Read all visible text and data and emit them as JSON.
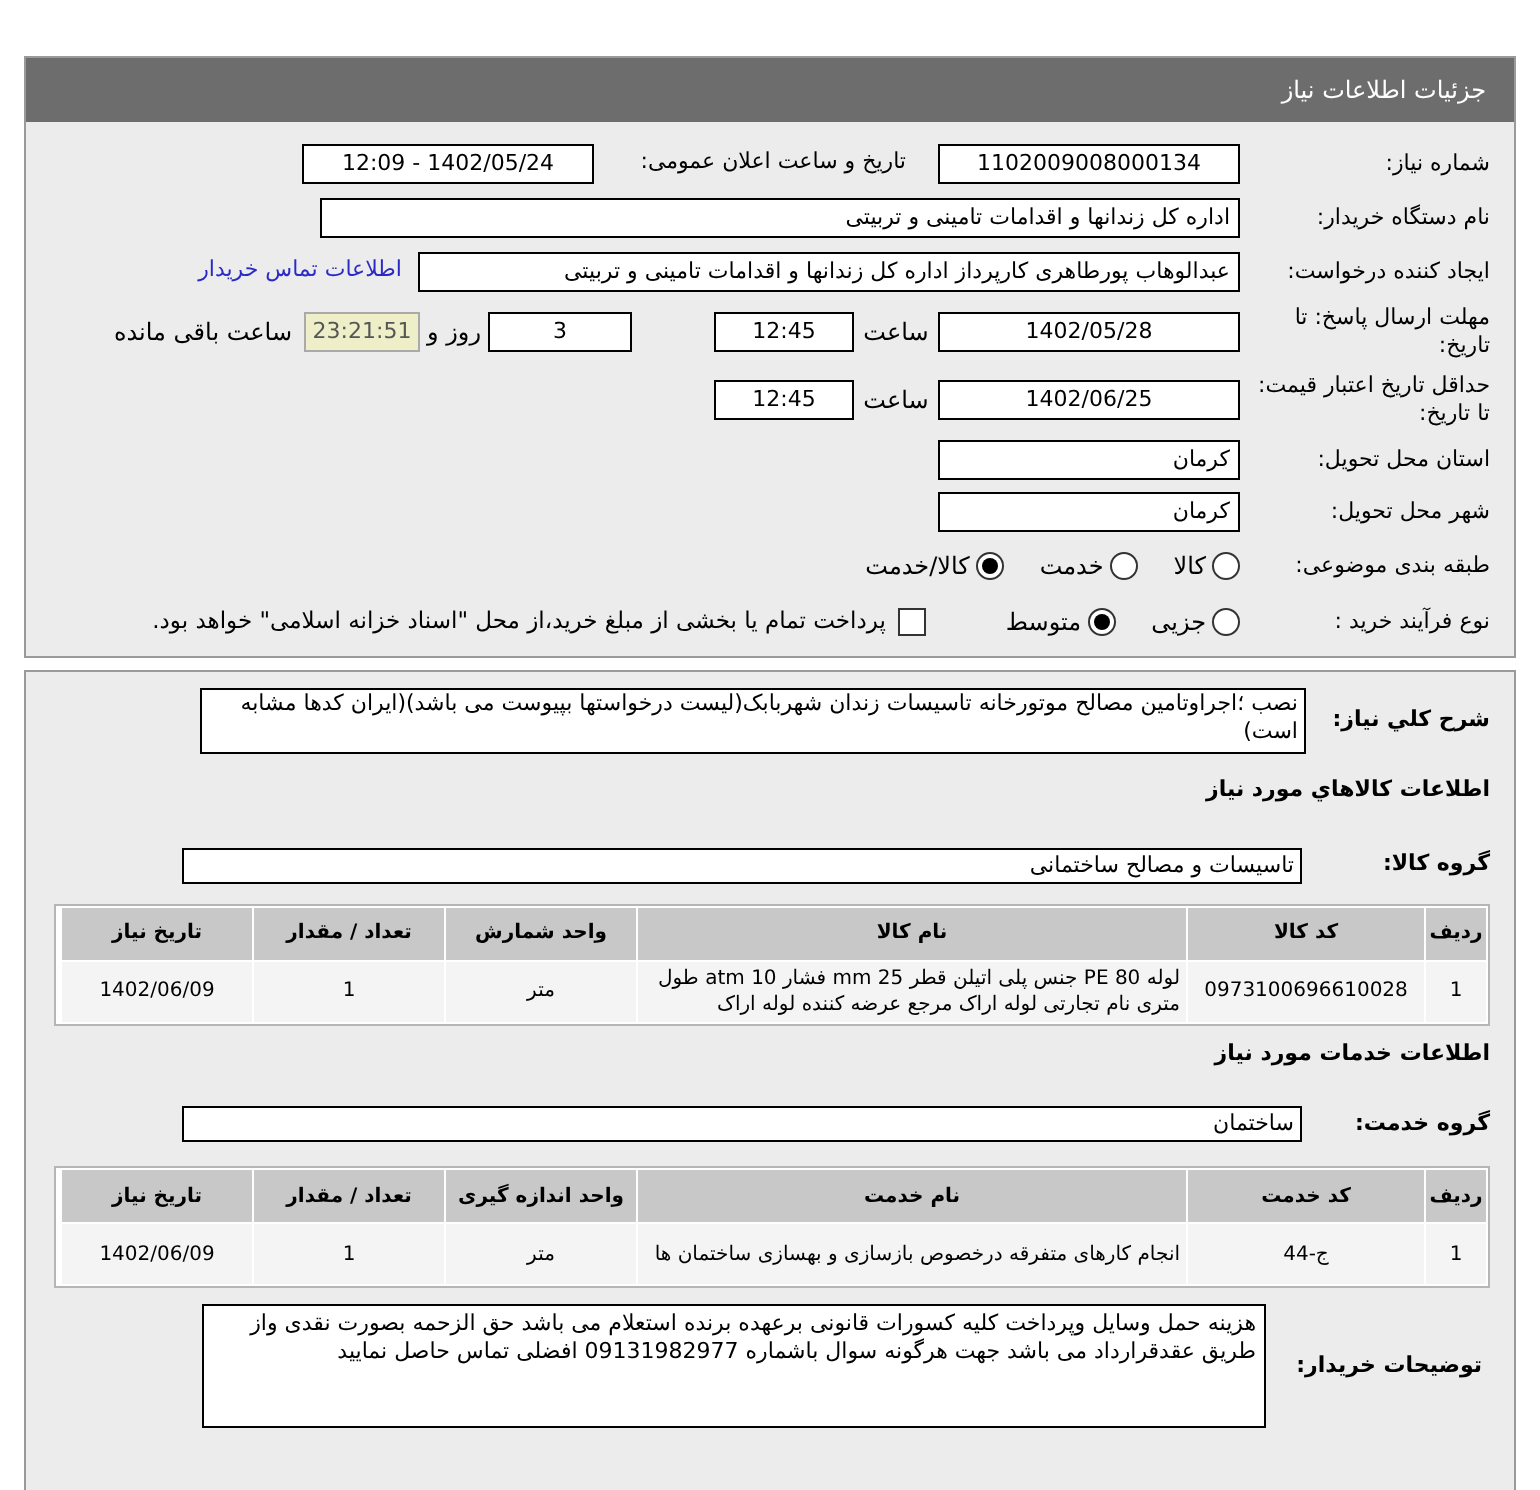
{
  "header": {
    "title": "جزئیات اطلاعات نیاز"
  },
  "need_number": {
    "label": "شماره نیاز:",
    "value": "1102009008000134"
  },
  "announce": {
    "label": "تاریخ و ساعت اعلان عمومی:",
    "value": "1402/05/24 - 12:09"
  },
  "buyer_org": {
    "label": "نام دستگاه خریدار:",
    "value": "اداره کل زندانها و اقدامات تامینی و تربیتی"
  },
  "requester": {
    "label": "ایجاد کننده درخواست:",
    "value": "عبدالوهاب پورطاهری کارپرداز اداره کل زندانها و اقدامات تامینی و تربیتی",
    "link": "اطلاعات تماس خریدار"
  },
  "deadline": {
    "label": "مهلت ارسال پاسخ: تا تاریخ:",
    "date": "1402/05/28",
    "time_label": "ساعت",
    "time": "12:45",
    "days": "3",
    "days_label": "روز و",
    "remaining": "23:21:51",
    "remaining_label": "ساعت باقی مانده"
  },
  "validity": {
    "label": "حداقل تاریخ اعتبار قیمت: تا تاریخ:",
    "date": "1402/06/25",
    "time_label": "ساعت",
    "time": "12:45"
  },
  "province": {
    "label": "استان محل تحویل:",
    "value": "کرمان"
  },
  "city": {
    "label": "شهر محل تحویل:",
    "value": "کرمان"
  },
  "category": {
    "label": "طبقه بندی موضوعی:",
    "options": [
      {
        "label": "کالا",
        "selected": false
      },
      {
        "label": "خدمت",
        "selected": false
      },
      {
        "label": "کالا/خدمت",
        "selected": true
      }
    ]
  },
  "process": {
    "label": "نوع فرآیند خرید :",
    "options": [
      {
        "label": "جزیی",
        "selected": false
      },
      {
        "label": "متوسط",
        "selected": true
      }
    ],
    "checkbox": {
      "label": "پرداخت تمام یا بخشی از مبلغ خرید،از محل \"اسناد خزانه اسلامی\" خواهد بود.",
      "checked": false
    }
  },
  "description": {
    "label": "شرح کلي نياز:",
    "value": "نصب ؛اجراوتامین مصالح موتورخانه تاسیسات زندان شهربابک(لیست درخواستها بپیوست می باشد)(ایران کدها مشابه است)"
  },
  "goods_title": "اطلاعات کالاهاي مورد نياز",
  "goods_group": {
    "label": "گروه کالا:",
    "value": "تاسیسات و مصالح ساختمانی"
  },
  "goods_table": {
    "columns": [
      "ردیف",
      "کد کالا",
      "نام کالا",
      "واحد شمارش",
      "تعداد / مقدار",
      "تاریخ نیاز"
    ],
    "rows": [
      [
        "1",
        "0973100696610028",
        "لوله PE 80 جنس پلی اتیلن قطر 25 mm فشار 10 atm طول متری نام تجارتی لوله اراک مرجع عرضه کننده لوله اراک",
        "متر",
        "1",
        "1402/06/09"
      ]
    ]
  },
  "services_title": "اطلاعات خدمات مورد نیاز",
  "service_group": {
    "label": "گروه خدمت:",
    "value": "ساختمان"
  },
  "services_table": {
    "columns": [
      "ردیف",
      "کد خدمت",
      "نام خدمت",
      "واحد اندازه گیری",
      "تعداد / مقدار",
      "تاریخ نیاز"
    ],
    "rows": [
      [
        "1",
        "ج-44",
        "انجام کارهای متفرقه درخصوص بازسازی و بهسازی ساختمان ها",
        "متر",
        "1",
        "1402/06/09"
      ]
    ]
  },
  "buyer_notes": {
    "label": "توضیحات خریدار:",
    "value": "هزینه حمل وسایل وپرداخت کلیه کسورات قانونی برعهده برنده استعلام می باشد حق الزحمه بصورت نقدی واز طریق عقدقرارداد می باشد جهت هرگونه سوال باشماره 09131982977 افضلی تماس حاصل نمایید"
  }
}
